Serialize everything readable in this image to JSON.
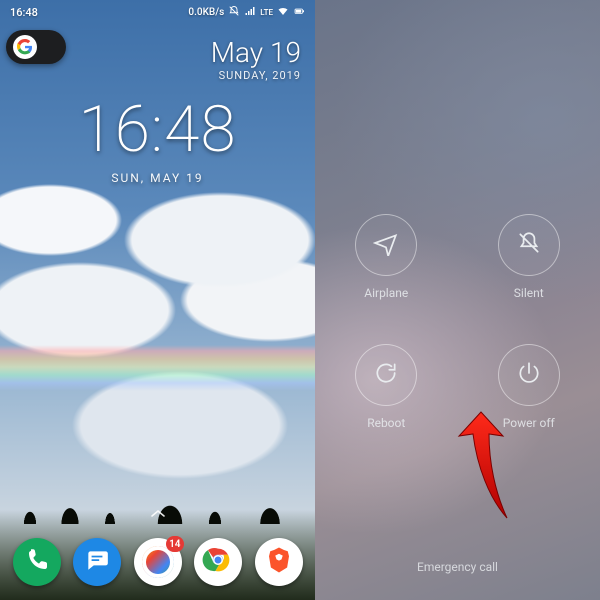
{
  "status": {
    "time": "16:48",
    "net_speed": "0.0KB/s",
    "lte_label": "LTE"
  },
  "date_widget": {
    "line1": "May 19",
    "line2": "SUNDAY, 2019"
  },
  "clock": {
    "time": "16:48",
    "date": "SUN, MAY 19"
  },
  "dock": {
    "drive_badge": "14"
  },
  "power_menu": {
    "airplane": "Airplane",
    "silent": "Silent",
    "reboot": "Reboot",
    "poweroff": "Power off",
    "emergency": "Emergency call"
  }
}
